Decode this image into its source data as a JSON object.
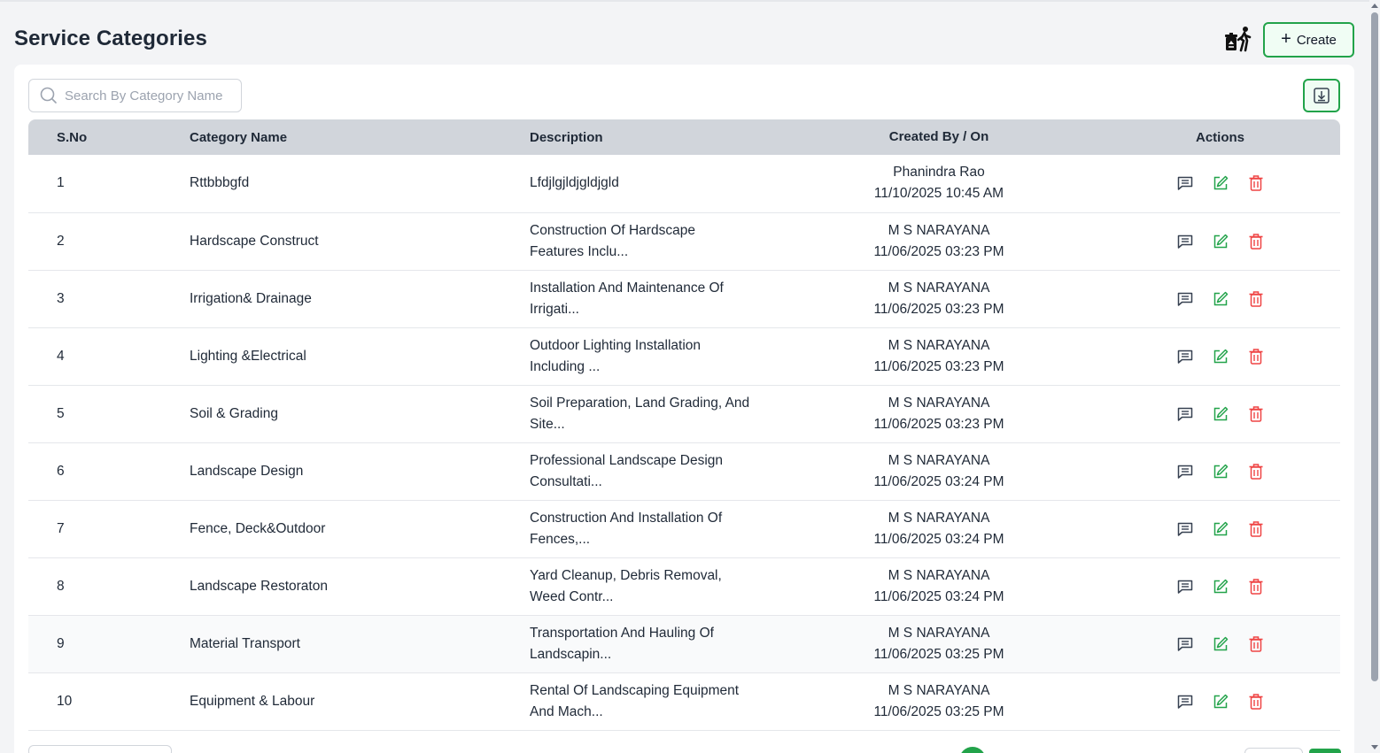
{
  "page": {
    "title": "Service Categories"
  },
  "toolbar": {
    "create_label": "Create",
    "recycle_icon": "recycle-bin-person-icon",
    "download_icon": "download-icon"
  },
  "search": {
    "placeholder": "Search By Category Name",
    "value": ""
  },
  "table": {
    "headers": {
      "sno": "S.No",
      "name": "Category Name",
      "description": "Description",
      "created": "Created By / On",
      "actions": "Actions"
    },
    "rows": [
      {
        "sno": "1",
        "name": "Rttbbbgfd",
        "description": "Lfdjlgjldjgldjgld",
        "created_by": "Phanindra Rao",
        "created_on": "11/10/2025 10:45 AM"
      },
      {
        "sno": "2",
        "name": "Hardscape Construct",
        "description": "Construction Of Hardscape Features Inclu...",
        "created_by": "M S NARAYANA",
        "created_on": "11/06/2025 03:23 PM"
      },
      {
        "sno": "3",
        "name": "Irrigation& Drainage",
        "description": "Installation And Maintenance Of Irrigati...",
        "created_by": "M S NARAYANA",
        "created_on": "11/06/2025 03:23 PM"
      },
      {
        "sno": "4",
        "name": "Lighting &Electrical",
        "description": "Outdoor Lighting Installation Including ...",
        "created_by": "M S NARAYANA",
        "created_on": "11/06/2025 03:23 PM"
      },
      {
        "sno": "5",
        "name": "Soil & Grading",
        "description": "Soil Preparation, Land Grading, And Site...",
        "created_by": "M S NARAYANA",
        "created_on": "11/06/2025 03:23 PM"
      },
      {
        "sno": "6",
        "name": "Landscape Design",
        "description": "Professional Landscape Design Consultati...",
        "created_by": "M S NARAYANA",
        "created_on": "11/06/2025 03:24 PM"
      },
      {
        "sno": "7",
        "name": "Fence, Deck&Outdoor",
        "description": "Construction And Installation Of Fences,...",
        "created_by": "M S NARAYANA",
        "created_on": "11/06/2025 03:24 PM"
      },
      {
        "sno": "8",
        "name": "Landscape Restoraton",
        "description": "Yard Cleanup, Debris Removal, Weed Contr...",
        "created_by": "M S NARAYANA",
        "created_on": "11/06/2025 03:24 PM"
      },
      {
        "sno": "9",
        "name": "Material Transport",
        "description": "Transportation And Hauling Of Landscapin...",
        "created_by": "M S NARAYANA",
        "created_on": "11/06/2025 03:25 PM"
      },
      {
        "sno": "10",
        "name": "Equipment & Labour",
        "description": "Rental Of Landscaping Equipment And Mach...",
        "created_by": "M S NARAYANA",
        "created_on": "11/06/2025 03:25 PM"
      }
    ]
  },
  "colors": {
    "accent": "#22a34a",
    "danger": "#ef4444",
    "edit": "#22a34a",
    "header_bg": "#d1d5db"
  }
}
